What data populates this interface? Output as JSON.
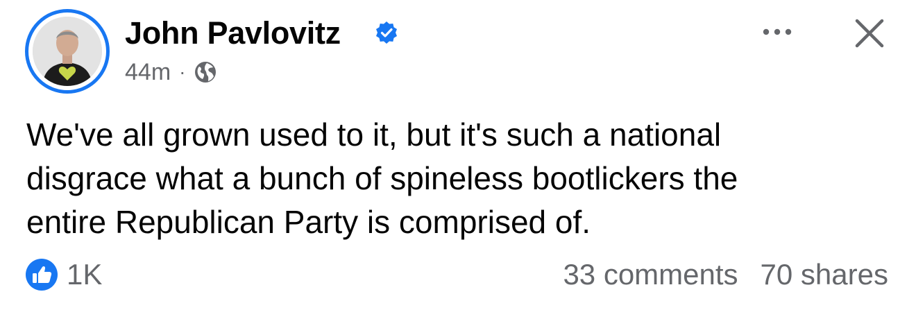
{
  "post": {
    "author": {
      "name": "John Pavlovitz",
      "verified_icon": "verified-badge-icon",
      "avatar_icon": "profile-photo"
    },
    "meta": {
      "time": "44m",
      "separator": "·",
      "audience_icon": "globe-icon"
    },
    "actions": {
      "more_icon": "more-options-icon",
      "close_icon": "close-icon"
    },
    "text_lines": [
      "We've all grown used to it, but it's such a national",
      "disgrace what a bunch of spineless bootlickers the",
      "entire Republican Party is comprised of."
    ],
    "footer": {
      "reaction_icon": "like-icon",
      "reaction_count": "1K",
      "comments": "33 comments",
      "shares": "70 shares"
    }
  },
  "colors": {
    "accent": "#1877f2",
    "secondary_text": "#65676b",
    "primary_text": "#050505",
    "background": "#ffffff"
  }
}
